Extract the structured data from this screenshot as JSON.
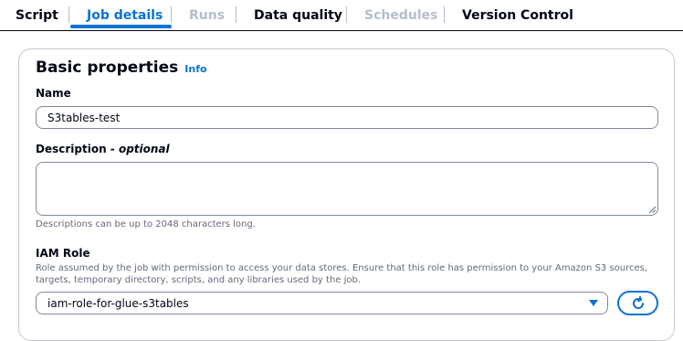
{
  "tabs": [
    {
      "label": "Script",
      "state": "normal"
    },
    {
      "label": "Job details",
      "state": "active"
    },
    {
      "label": "Runs",
      "state": "disabled"
    },
    {
      "label": "Data quality",
      "state": "normal"
    },
    {
      "label": "Schedules",
      "state": "disabled"
    },
    {
      "label": "Version Control",
      "state": "normal"
    }
  ],
  "section": {
    "title": "Basic properties",
    "info_label": "Info"
  },
  "name_field": {
    "label": "Name",
    "value": "S3tables-test"
  },
  "description_field": {
    "label": "Description - ",
    "label_optional": "optional",
    "value": "",
    "hint": "Descriptions can be up to 2048 characters long."
  },
  "iam_role": {
    "label": "IAM Role",
    "description_line1": "Role assumed by the job with permission to access your data stores. Ensure that this role has permission to your Amazon S3 sources,",
    "description_line2": "targets, temporary directory, scripts, and any libraries used by the job.",
    "selected_value": "iam-role-for-glue-s3tables"
  },
  "icons": {
    "dropdown": "caret-down-icon",
    "refresh": "refresh-icon",
    "resize": "resize-grip-icon"
  },
  "colors": {
    "accent": "#0972d3",
    "text": "#000716",
    "disabled": "#b6bec9",
    "hint": "#5f6b7a",
    "border": "#7d8998"
  }
}
